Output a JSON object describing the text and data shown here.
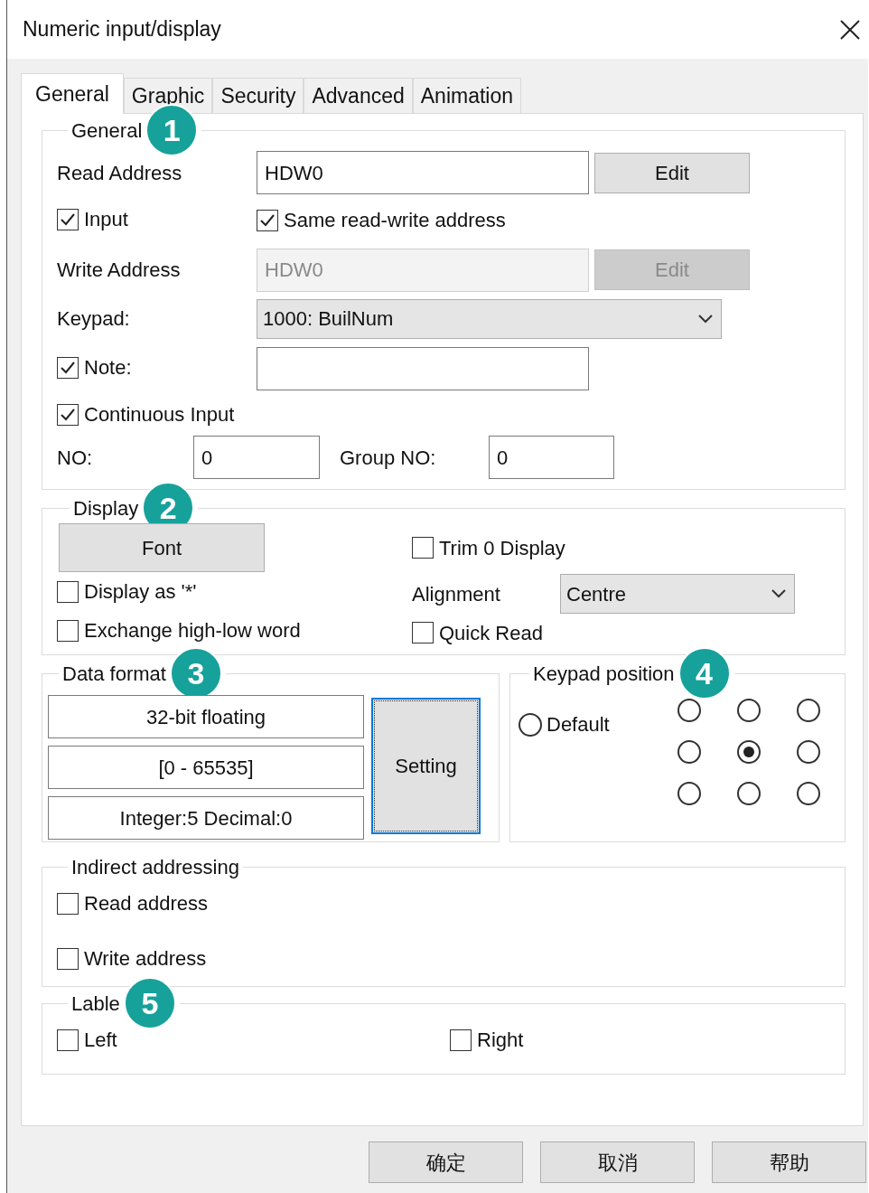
{
  "window": {
    "title": "Numeric input/display"
  },
  "tabs": [
    {
      "label": "General",
      "selected": true
    },
    {
      "label": "Graphic",
      "selected": false
    },
    {
      "label": "Security",
      "selected": false
    },
    {
      "label": "Advanced",
      "selected": false
    },
    {
      "label": "Animation",
      "selected": false
    }
  ],
  "general": {
    "title": "General",
    "badge": "1",
    "read_address": {
      "label": "Read Address",
      "value": "HDW0",
      "button": "Edit",
      "disabled": false
    },
    "input": {
      "label": "Input",
      "checked": true
    },
    "same_address": {
      "label": "Same read-write address",
      "checked": true
    },
    "write_address": {
      "label": "Write Address",
      "value": "HDW0",
      "button": "Edit",
      "disabled": true
    },
    "keypad": {
      "label": "Keypad:",
      "value": "1000: BuilNum"
    },
    "note": {
      "label": "Note:",
      "checked": true
    },
    "continuous_input": {
      "label": "Continuous Input",
      "checked": true
    },
    "no": {
      "label": "NO:",
      "value": "0"
    },
    "group_no": {
      "label": "Group NO:",
      "value": "0"
    }
  },
  "display": {
    "title": "Display",
    "badge": "2",
    "font_button": "Font",
    "trim_zero": {
      "label": "Trim 0 Display",
      "checked": false
    },
    "display_as_star": {
      "label": "Display as '*'",
      "checked": false
    },
    "alignment": {
      "label": "Alignment",
      "value": "Centre"
    },
    "exchange_word": {
      "label": "Exchange high-low word",
      "checked": false
    },
    "quick_read": {
      "label": "Quick Read",
      "checked": false
    }
  },
  "data_format": {
    "title": "Data format",
    "badge": "3",
    "lines": [
      "32-bit floating",
      "[0 - 65535]",
      "Integer:5 Decimal:0"
    ],
    "button": "Setting"
  },
  "keypad_position": {
    "title": "Keypad position",
    "badge": "4",
    "default": {
      "label": "Default",
      "selected": false
    },
    "positions": [
      {
        "selected": false
      },
      {
        "selected": false
      },
      {
        "selected": false
      },
      {
        "selected": false
      },
      {
        "selected": true
      },
      {
        "selected": false
      },
      {
        "selected": false
      },
      {
        "selected": false
      },
      {
        "selected": false
      }
    ]
  },
  "indirect_addressing": {
    "title": "Indirect addressing",
    "items": [
      {
        "label": "Read address",
        "checked": false
      },
      {
        "label": "Write address",
        "checked": false
      }
    ]
  },
  "lable": {
    "title": "Lable",
    "badge": "5",
    "items": [
      {
        "label": "Left",
        "checked": false
      },
      {
        "label": "Right",
        "checked": false
      }
    ]
  },
  "buttons": [
    "确定",
    "取消",
    "帮助"
  ]
}
